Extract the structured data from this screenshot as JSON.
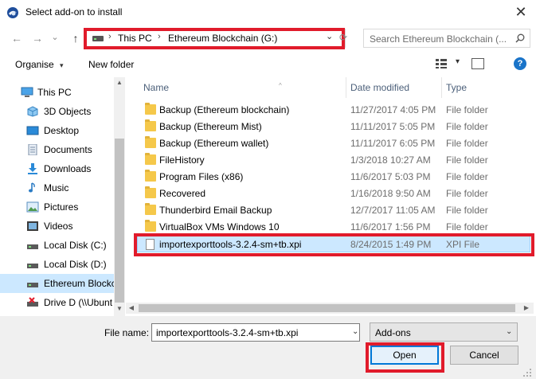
{
  "window": {
    "title": "Select add-on to install",
    "close_glyph": "✕"
  },
  "nav": {
    "back_glyph": "←",
    "forward_glyph": "→",
    "recent_glyph": "⌄",
    "up_glyph": "↑",
    "breadcrumb": [
      "This PC",
      "Ethereum Blockchain (G:)"
    ],
    "separator_glyph": "›",
    "dropdown_glyph": "⌄",
    "refresh_glyph": "⟳",
    "search_placeholder": "Search Ethereum Blockchain (..."
  },
  "toolbar": {
    "organise": "Organise",
    "organise_chevron": "▾",
    "new_folder": "New folder",
    "view_chevron": "▾",
    "help_glyph": "?"
  },
  "sidebar": {
    "items": [
      {
        "label": "This PC",
        "icon": "computer-icon",
        "top": true
      },
      {
        "label": "3D Objects",
        "icon": "3d-objects-icon"
      },
      {
        "label": "Desktop",
        "icon": "desktop-icon"
      },
      {
        "label": "Documents",
        "icon": "documents-icon"
      },
      {
        "label": "Downloads",
        "icon": "downloads-icon"
      },
      {
        "label": "Music",
        "icon": "music-icon"
      },
      {
        "label": "Pictures",
        "icon": "pictures-icon"
      },
      {
        "label": "Videos",
        "icon": "videos-icon"
      },
      {
        "label": "Local Disk (C:)",
        "icon": "drive-icon"
      },
      {
        "label": "Local Disk (D:)",
        "icon": "drive-icon"
      },
      {
        "label": "Ethereum Blockch",
        "icon": "drive-icon",
        "selected": true
      },
      {
        "label": "Drive D (\\\\Ubunt",
        "icon": "network-drive-icon"
      }
    ]
  },
  "columns": {
    "name": "Name",
    "date": "Date modified",
    "type": "Type",
    "sort_glyph": "^"
  },
  "files": [
    {
      "name": "Backup (Ethereum blockchain)",
      "date": "11/27/2017 4:05 PM",
      "type": "File folder",
      "kind": "folder"
    },
    {
      "name": "Backup (Ethereum Mist)",
      "date": "11/11/2017 5:05 PM",
      "type": "File folder",
      "kind": "folder"
    },
    {
      "name": "Backup (Ethereum wallet)",
      "date": "11/11/2017 6:05 PM",
      "type": "File folder",
      "kind": "folder"
    },
    {
      "name": "FileHistory",
      "date": "1/3/2018 10:27 AM",
      "type": "File folder",
      "kind": "folder"
    },
    {
      "name": "Program Files (x86)",
      "date": "11/6/2017 5:03 PM",
      "type": "File folder",
      "kind": "folder"
    },
    {
      "name": "Recovered",
      "date": "1/16/2018 9:50 AM",
      "type": "File folder",
      "kind": "folder"
    },
    {
      "name": "Thunderbird Email Backup",
      "date": "12/7/2017 11:05 AM",
      "type": "File folder",
      "kind": "folder"
    },
    {
      "name": "VirtualBox VMs Windows 10",
      "date": "11/6/2017 1:56 PM",
      "type": "File folder",
      "kind": "folder"
    },
    {
      "name": "importexporttools-3.2.4-sm+tb.xpi",
      "date": "8/24/2015 1:49 PM",
      "type": "XPI File",
      "kind": "file",
      "selected": true
    }
  ],
  "bottom": {
    "file_name_label": "File name:",
    "file_name_value": "importexporttools-3.2.4-sm+tb.xpi",
    "file_name_chevron": "⌄",
    "filter_value": "Add-ons",
    "filter_chevron": "⌄",
    "open_label": "Open",
    "cancel_label": "Cancel"
  },
  "colors": {
    "highlight_border": "#e11b2b",
    "selection_bg": "#cce8ff",
    "primary_button_border": "#0078d7"
  }
}
